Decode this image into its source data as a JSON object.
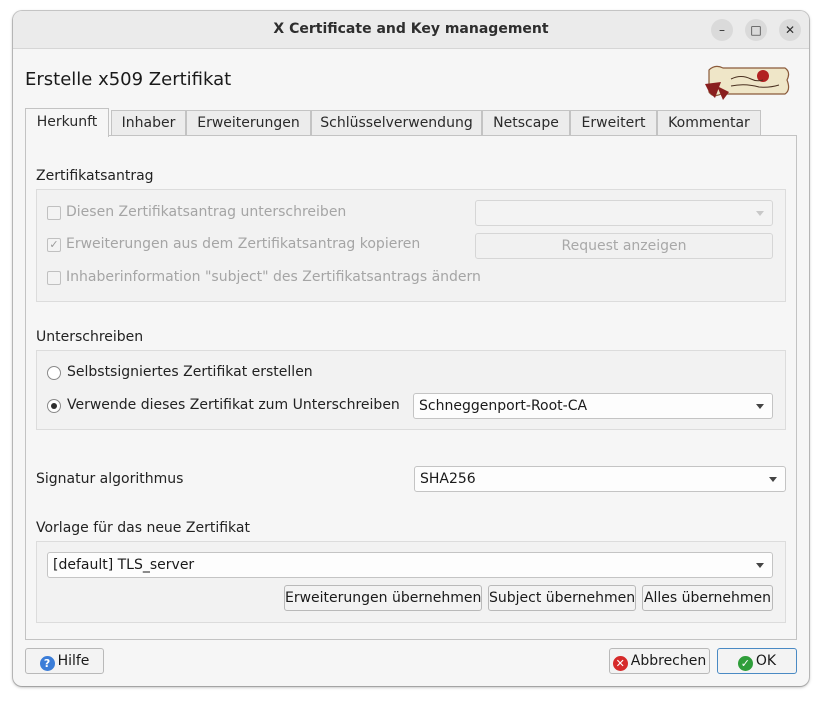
{
  "window": {
    "title": "X Certificate and Key management",
    "minimize": "–",
    "maximize": "□",
    "close": "✕"
  },
  "heading": "Erstelle x509 Zertifikat",
  "logo": {
    "text": "Zertifikat"
  },
  "tabs": [
    {
      "label": "Herkunft",
      "active": true
    },
    {
      "label": "Inhaber"
    },
    {
      "label": "Erweiterungen"
    },
    {
      "label": "Schlüsselverwendung"
    },
    {
      "label": "Netscape"
    },
    {
      "label": "Erweitert"
    },
    {
      "label": "Kommentar"
    }
  ],
  "request": {
    "section_title": "Zertifikatsantrag",
    "sign_request": "Diesen Zertifikatsantrag unterschreiben",
    "copy_extensions": "Erweiterungen aus dem Zertifikatsantrag kopieren",
    "modify_subject": "Inhaberinformation \"subject\" des Zertifikatsantrags ändern",
    "select_value": "",
    "show_request": "Request anzeigen",
    "checkmark": "✓"
  },
  "signing": {
    "section_title": "Unterschreiben",
    "self_signed": "Selbstsigniertes Zertifikat erstellen",
    "use_cert": "Verwende dieses Zertifikat zum Unterschreiben",
    "ca_value": "Schneggenport-Root-CA"
  },
  "algorithm": {
    "label": "Signatur algorithmus",
    "value": "SHA256"
  },
  "template": {
    "section_title": "Vorlage für das neue Zertifikat",
    "value": "[default] TLS_server",
    "apply_extensions": "Erweiterungen übernehmen",
    "apply_subject": "Subject übernehmen",
    "apply_all": "Alles übernehmen"
  },
  "footer": {
    "help": "Hilfe",
    "cancel": "Abbrechen",
    "ok": "OK"
  },
  "colors": {
    "help_icon": "#3b7dd8",
    "cancel_icon": "#d62a2a",
    "ok_icon": "#2f9e3a"
  }
}
